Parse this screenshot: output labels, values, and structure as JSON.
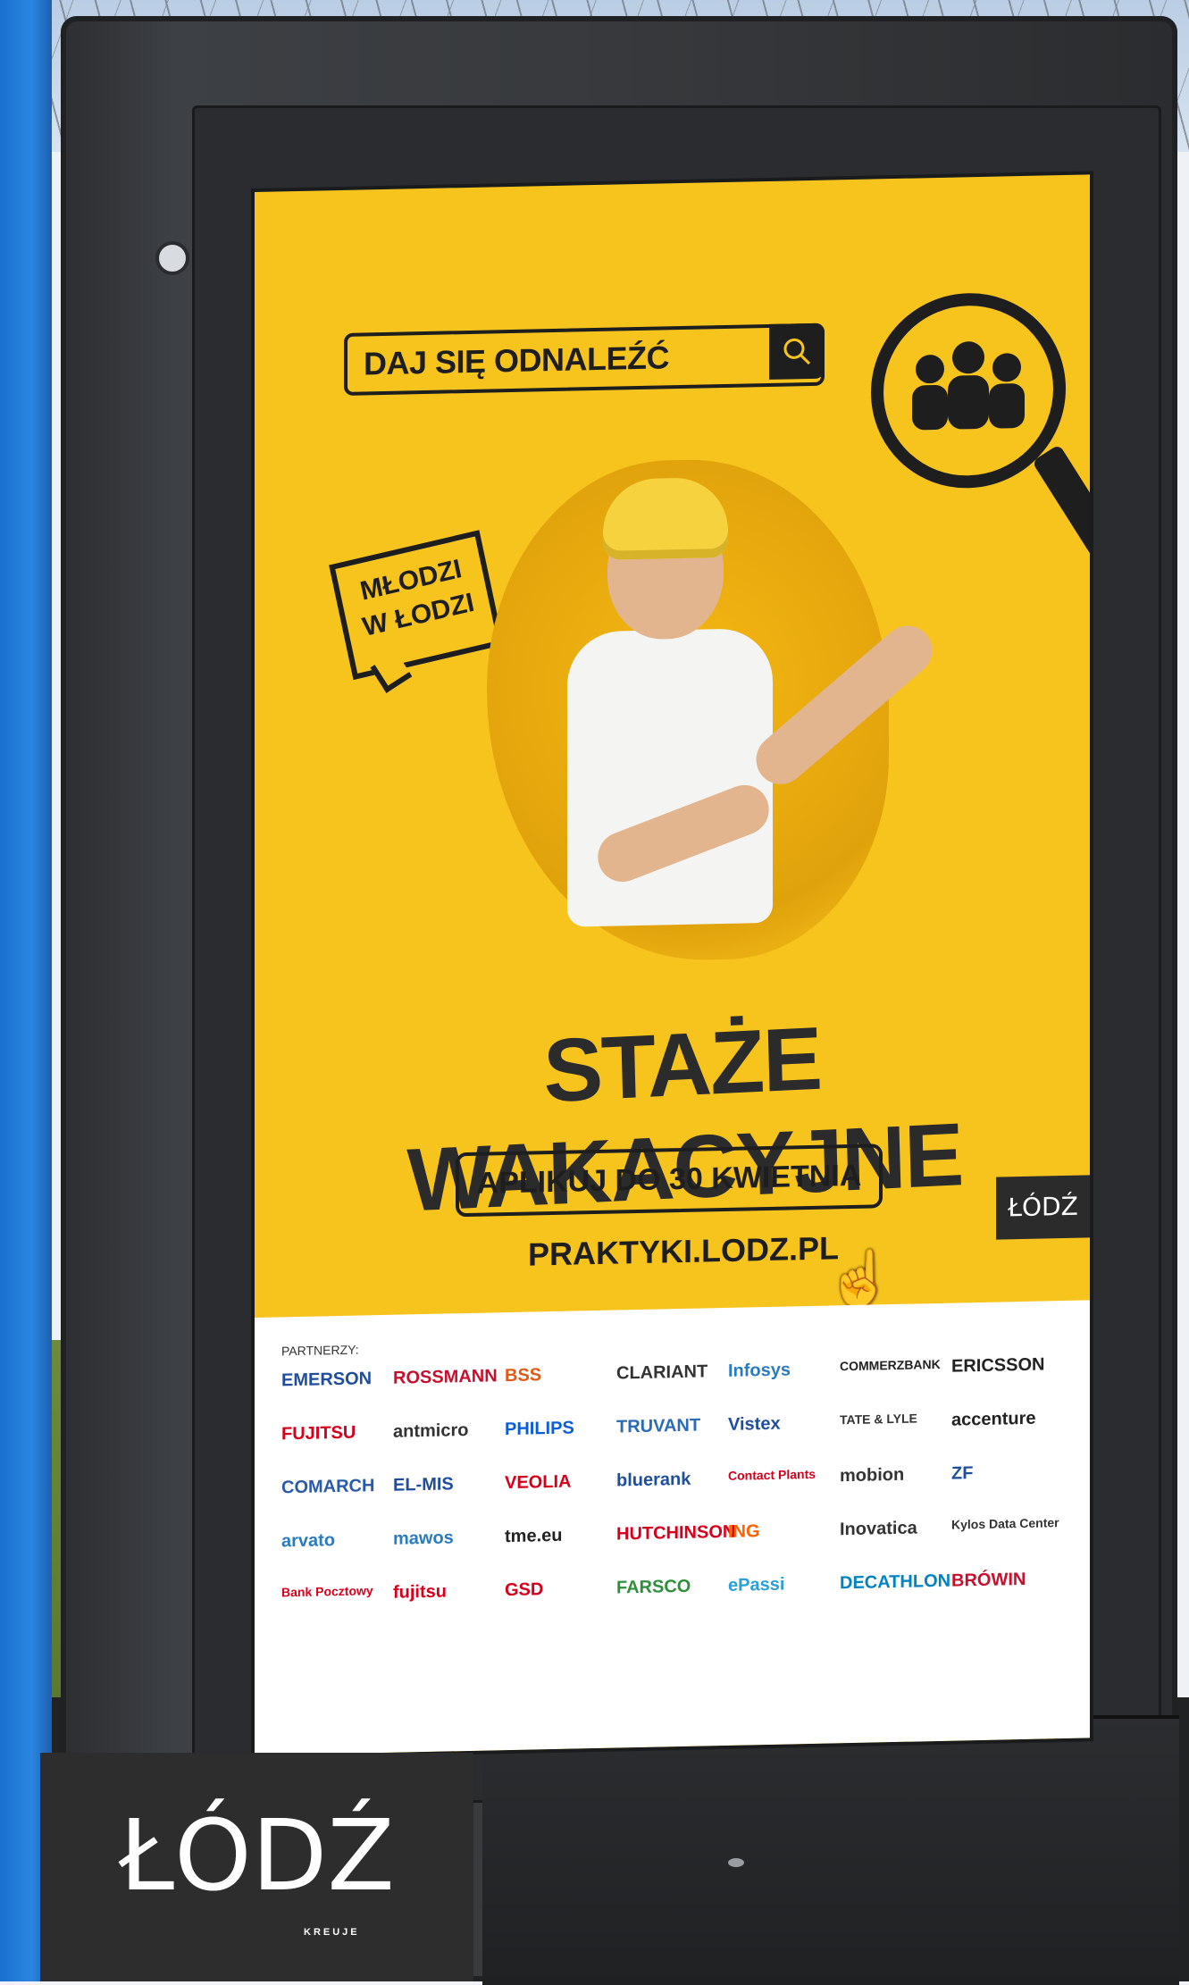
{
  "poster": {
    "search_text": "DAJ SIĘ ODNALEŹĆ",
    "badge_line1": "MŁODZI",
    "badge_line2": "W ŁODZI",
    "headline": "STAŻE WAKACYJNE",
    "apply_text": "APLIKUJ DO 30 KWIETNIA",
    "website": "PRAKTYKI.LODZ.PL",
    "brand_small": "ŁÓDŹ",
    "partners_label": "PARTNERZY:",
    "partners": [
      {
        "name": "EMERSON",
        "color": "#1f4e9c"
      },
      {
        "name": "ROSSMANN",
        "color": "#c8102e"
      },
      {
        "name": "BSS",
        "color": "#e05a16"
      },
      {
        "name": "CLARIANT",
        "color": "#333333"
      },
      {
        "name": "Infosys",
        "color": "#2b7bc0"
      },
      {
        "name": "COMMERZBANK",
        "color": "#222222"
      },
      {
        "name": "ERICSSON",
        "color": "#222222"
      },
      {
        "name": "FUJITSU",
        "color": "#d6001c"
      },
      {
        "name": "antmicro",
        "color": "#333333"
      },
      {
        "name": "PHILIPS",
        "color": "#0b5ed7"
      },
      {
        "name": "TRUVANT",
        "color": "#2d6cb5"
      },
      {
        "name": "Vistex",
        "color": "#1f4e9c"
      },
      {
        "name": "TATE & LYLE",
        "color": "#333333"
      },
      {
        "name": "accenture",
        "color": "#222222"
      },
      {
        "name": "COMARCH",
        "color": "#2b5aa8"
      },
      {
        "name": "EL-MIS",
        "color": "#1f4e9c"
      },
      {
        "name": "VEOLIA",
        "color": "#d6001c"
      },
      {
        "name": "bluerank",
        "color": "#1f4e9c"
      },
      {
        "name": "Contact Plants",
        "color": "#d6001c"
      },
      {
        "name": "mobion",
        "color": "#333333"
      },
      {
        "name": "ZF",
        "color": "#1f4e9c"
      },
      {
        "name": "arvato",
        "color": "#2b7bc0"
      },
      {
        "name": "mawos",
        "color": "#2b7bc0"
      },
      {
        "name": "tme.eu",
        "color": "#222222"
      },
      {
        "name": "HUTCHINSON",
        "color": "#d6001c"
      },
      {
        "name": "ING",
        "color": "#ff6200"
      },
      {
        "name": "Inovatica",
        "color": "#333333"
      },
      {
        "name": "Kylos Data Center",
        "color": "#333333"
      },
      {
        "name": "Bank Pocztowy",
        "color": "#d6001c"
      },
      {
        "name": "fujitsu",
        "color": "#d6001c"
      },
      {
        "name": "GSD",
        "color": "#d6001c"
      },
      {
        "name": "FARSCO",
        "color": "#2f8f3a"
      },
      {
        "name": "ePassi",
        "color": "#2b9fd6"
      },
      {
        "name": "DECATHLON",
        "color": "#0082c3"
      },
      {
        "name": "BRÓWIN",
        "color": "#c8102e"
      }
    ]
  },
  "corner_logo": {
    "mark": "ŁÓDŹ",
    "sub": "KREUJE"
  }
}
